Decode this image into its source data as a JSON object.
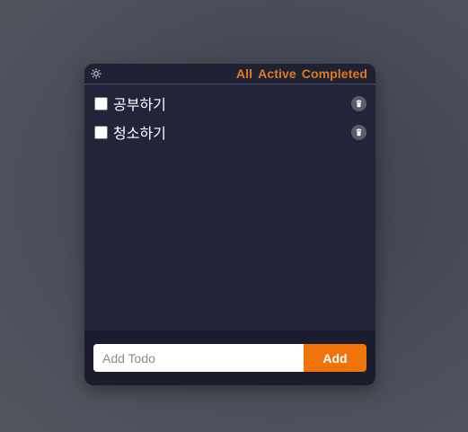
{
  "header": {
    "theme_icon": "sun-icon",
    "filters": [
      {
        "label": "All"
      },
      {
        "label": "Active"
      },
      {
        "label": "Completed"
      }
    ]
  },
  "todos": [
    {
      "text": "공부하기",
      "completed": false,
      "delete_icon": "trash-icon"
    },
    {
      "text": "청소하기",
      "completed": false,
      "delete_icon": "trash-icon"
    }
  ],
  "form": {
    "placeholder": "Add Todo",
    "value": "",
    "add_label": "Add"
  },
  "colors": {
    "accent": "#f07409",
    "filter_text": "#e07a1f",
    "panel_bg": "#22243a",
    "footer_bg": "#1b1d2e"
  }
}
